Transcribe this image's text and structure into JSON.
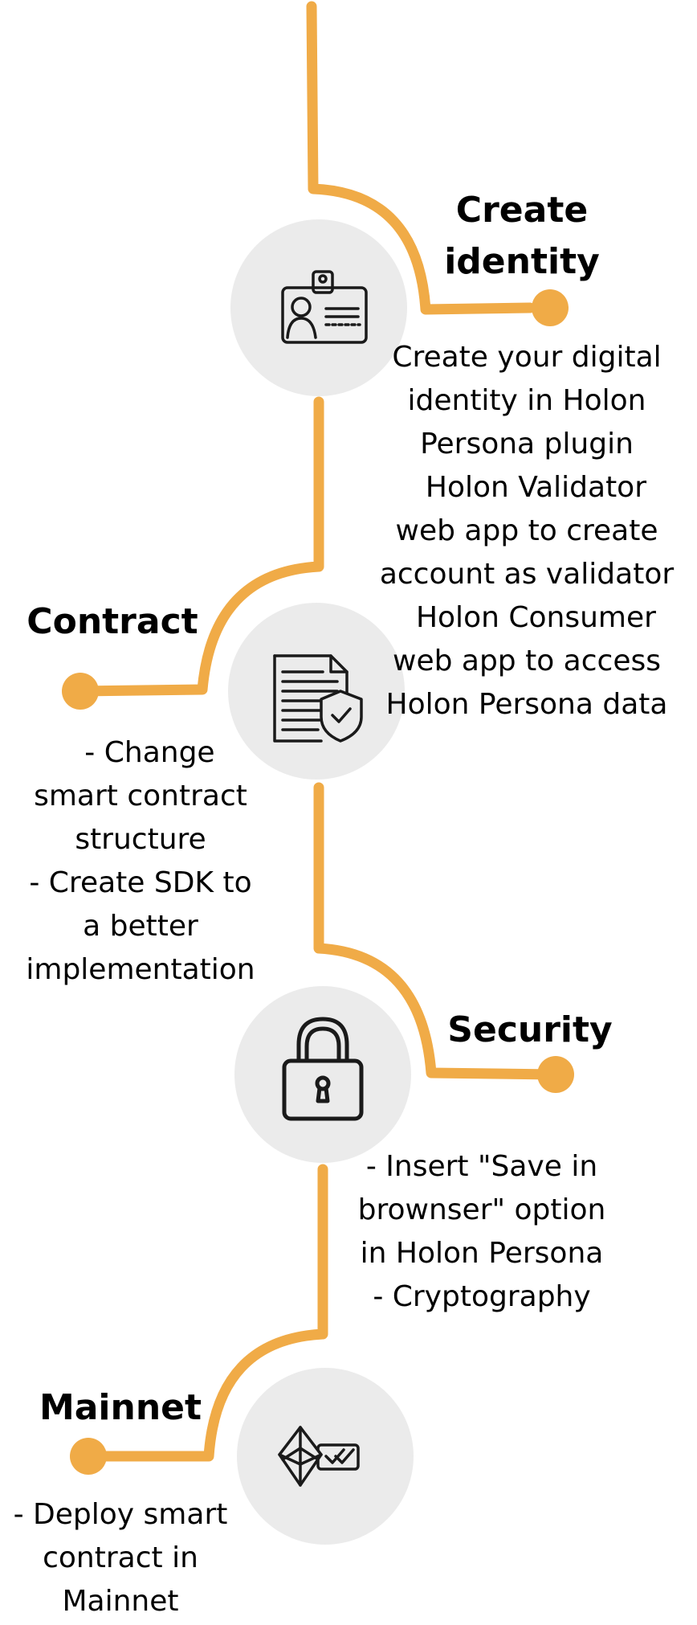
{
  "colors": {
    "path": "#f0ab47",
    "icon_circle": "#ebebeb",
    "icon_stroke": "#1a1a1a",
    "text": "#000000",
    "background": "#ffffff"
  },
  "steps": [
    {
      "title": [
        "Create",
        "identity"
      ],
      "icon": "id-badge-icon",
      "description": [
        "Create your digital",
        "identity in Holon",
        "Persona plugin",
        "  Holon Validator",
        "web app to create",
        "account as validator",
        "  Holon Consumer",
        "web app to access",
        "Holon Persona data"
      ]
    },
    {
      "title": [
        "Contract"
      ],
      "icon": "shield-document-icon",
      "description": [
        "  - Change",
        "smart contract",
        "structure",
        "- Create SDK to",
        "a better",
        "implementation"
      ]
    },
    {
      "title": [
        "Security"
      ],
      "icon": "padlock-icon",
      "description": [
        "- Insert \"Save in",
        "brownser\" option",
        "in Holon Persona",
        "- Cryptography"
      ]
    },
    {
      "title": [
        "Mainnet"
      ],
      "icon": "ethereum-ticket-icon",
      "description": [
        "- Deploy smart",
        "contract in",
        "Mainnet"
      ]
    }
  ]
}
